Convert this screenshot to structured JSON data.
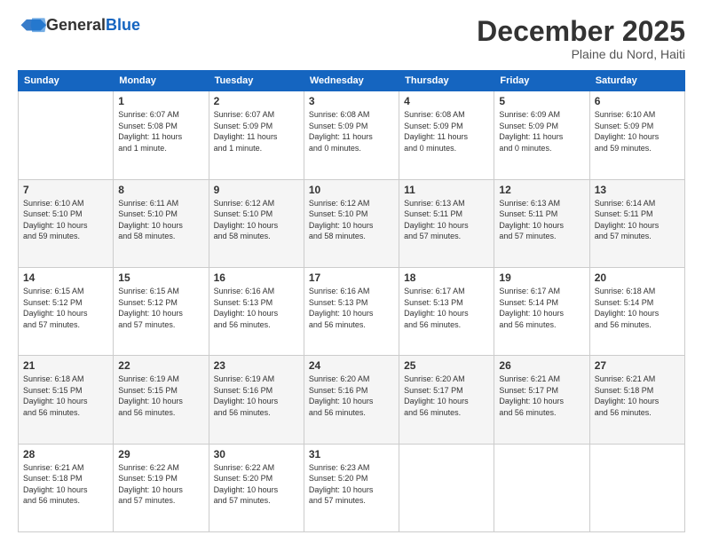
{
  "header": {
    "logo_general": "General",
    "logo_blue": "Blue",
    "month_title": "December 2025",
    "subtitle": "Plaine du Nord, Haiti"
  },
  "days_of_week": [
    "Sunday",
    "Monday",
    "Tuesday",
    "Wednesday",
    "Thursday",
    "Friday",
    "Saturday"
  ],
  "weeks": [
    [
      {
        "day": "",
        "info": ""
      },
      {
        "day": "1",
        "info": "Sunrise: 6:07 AM\nSunset: 5:08 PM\nDaylight: 11 hours\nand 1 minute."
      },
      {
        "day": "2",
        "info": "Sunrise: 6:07 AM\nSunset: 5:09 PM\nDaylight: 11 hours\nand 1 minute."
      },
      {
        "day": "3",
        "info": "Sunrise: 6:08 AM\nSunset: 5:09 PM\nDaylight: 11 hours\nand 0 minutes."
      },
      {
        "day": "4",
        "info": "Sunrise: 6:08 AM\nSunset: 5:09 PM\nDaylight: 11 hours\nand 0 minutes."
      },
      {
        "day": "5",
        "info": "Sunrise: 6:09 AM\nSunset: 5:09 PM\nDaylight: 11 hours\nand 0 minutes."
      },
      {
        "day": "6",
        "info": "Sunrise: 6:10 AM\nSunset: 5:09 PM\nDaylight: 10 hours\nand 59 minutes."
      }
    ],
    [
      {
        "day": "7",
        "info": "Sunrise: 6:10 AM\nSunset: 5:10 PM\nDaylight: 10 hours\nand 59 minutes."
      },
      {
        "day": "8",
        "info": "Sunrise: 6:11 AM\nSunset: 5:10 PM\nDaylight: 10 hours\nand 58 minutes."
      },
      {
        "day": "9",
        "info": "Sunrise: 6:12 AM\nSunset: 5:10 PM\nDaylight: 10 hours\nand 58 minutes."
      },
      {
        "day": "10",
        "info": "Sunrise: 6:12 AM\nSunset: 5:10 PM\nDaylight: 10 hours\nand 58 minutes."
      },
      {
        "day": "11",
        "info": "Sunrise: 6:13 AM\nSunset: 5:11 PM\nDaylight: 10 hours\nand 57 minutes."
      },
      {
        "day": "12",
        "info": "Sunrise: 6:13 AM\nSunset: 5:11 PM\nDaylight: 10 hours\nand 57 minutes."
      },
      {
        "day": "13",
        "info": "Sunrise: 6:14 AM\nSunset: 5:11 PM\nDaylight: 10 hours\nand 57 minutes."
      }
    ],
    [
      {
        "day": "14",
        "info": "Sunrise: 6:15 AM\nSunset: 5:12 PM\nDaylight: 10 hours\nand 57 minutes."
      },
      {
        "day": "15",
        "info": "Sunrise: 6:15 AM\nSunset: 5:12 PM\nDaylight: 10 hours\nand 57 minutes."
      },
      {
        "day": "16",
        "info": "Sunrise: 6:16 AM\nSunset: 5:13 PM\nDaylight: 10 hours\nand 56 minutes."
      },
      {
        "day": "17",
        "info": "Sunrise: 6:16 AM\nSunset: 5:13 PM\nDaylight: 10 hours\nand 56 minutes."
      },
      {
        "day": "18",
        "info": "Sunrise: 6:17 AM\nSunset: 5:13 PM\nDaylight: 10 hours\nand 56 minutes."
      },
      {
        "day": "19",
        "info": "Sunrise: 6:17 AM\nSunset: 5:14 PM\nDaylight: 10 hours\nand 56 minutes."
      },
      {
        "day": "20",
        "info": "Sunrise: 6:18 AM\nSunset: 5:14 PM\nDaylight: 10 hours\nand 56 minutes."
      }
    ],
    [
      {
        "day": "21",
        "info": "Sunrise: 6:18 AM\nSunset: 5:15 PM\nDaylight: 10 hours\nand 56 minutes."
      },
      {
        "day": "22",
        "info": "Sunrise: 6:19 AM\nSunset: 5:15 PM\nDaylight: 10 hours\nand 56 minutes."
      },
      {
        "day": "23",
        "info": "Sunrise: 6:19 AM\nSunset: 5:16 PM\nDaylight: 10 hours\nand 56 minutes."
      },
      {
        "day": "24",
        "info": "Sunrise: 6:20 AM\nSunset: 5:16 PM\nDaylight: 10 hours\nand 56 minutes."
      },
      {
        "day": "25",
        "info": "Sunrise: 6:20 AM\nSunset: 5:17 PM\nDaylight: 10 hours\nand 56 minutes."
      },
      {
        "day": "26",
        "info": "Sunrise: 6:21 AM\nSunset: 5:17 PM\nDaylight: 10 hours\nand 56 minutes."
      },
      {
        "day": "27",
        "info": "Sunrise: 6:21 AM\nSunset: 5:18 PM\nDaylight: 10 hours\nand 56 minutes."
      }
    ],
    [
      {
        "day": "28",
        "info": "Sunrise: 6:21 AM\nSunset: 5:18 PM\nDaylight: 10 hours\nand 56 minutes."
      },
      {
        "day": "29",
        "info": "Sunrise: 6:22 AM\nSunset: 5:19 PM\nDaylight: 10 hours\nand 57 minutes."
      },
      {
        "day": "30",
        "info": "Sunrise: 6:22 AM\nSunset: 5:20 PM\nDaylight: 10 hours\nand 57 minutes."
      },
      {
        "day": "31",
        "info": "Sunrise: 6:23 AM\nSunset: 5:20 PM\nDaylight: 10 hours\nand 57 minutes."
      },
      {
        "day": "",
        "info": ""
      },
      {
        "day": "",
        "info": ""
      },
      {
        "day": "",
        "info": ""
      }
    ]
  ]
}
